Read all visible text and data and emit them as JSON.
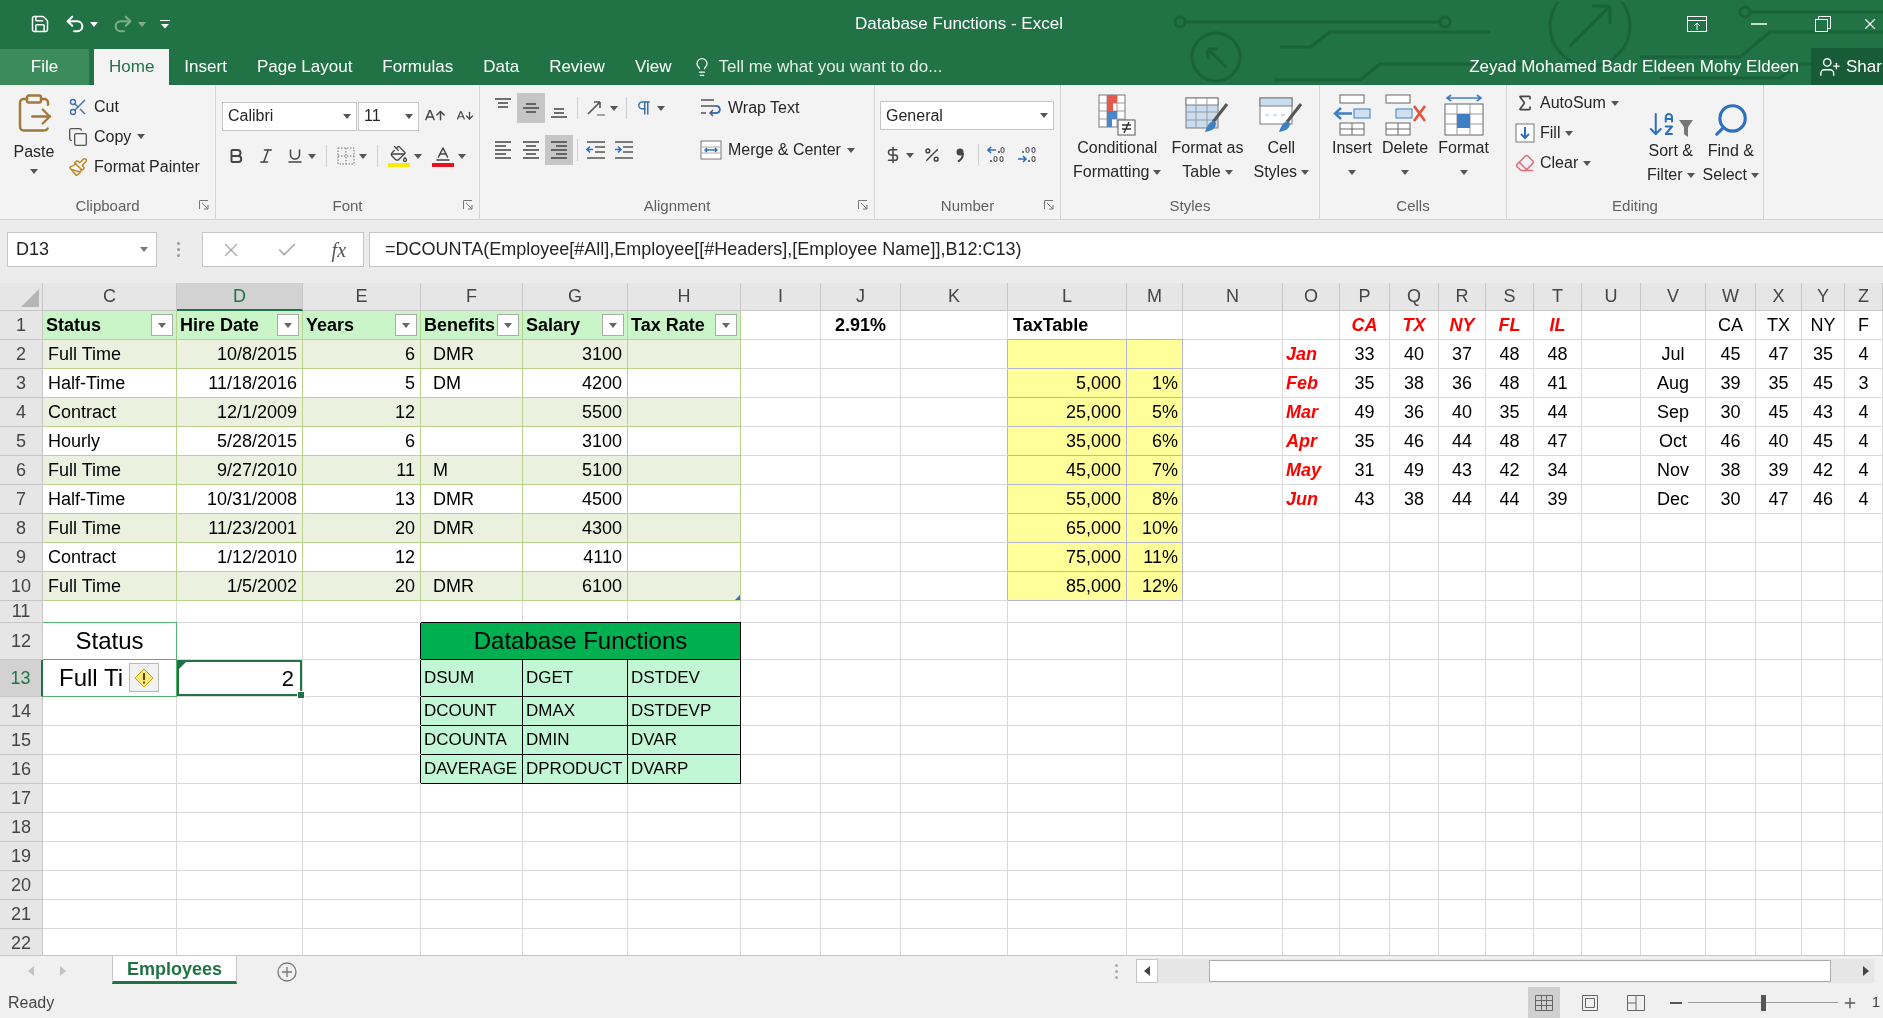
{
  "window": {
    "title": "Database Functions - Excel"
  },
  "quick_access": [
    {
      "kind": "save",
      "disabled": false
    },
    {
      "kind": "undo",
      "disabled": false
    },
    {
      "kind": "redo",
      "disabled": true
    },
    {
      "kind": "customize",
      "disabled": false
    }
  ],
  "tabs": [
    {
      "label": "File",
      "kind": "file",
      "selected": false
    },
    {
      "label": "Home",
      "kind": "tab",
      "selected": true
    },
    {
      "label": "Insert",
      "kind": "tab",
      "selected": false
    },
    {
      "label": "Page Layout",
      "kind": "tab",
      "selected": false
    },
    {
      "label": "Formulas",
      "kind": "tab",
      "selected": false
    },
    {
      "label": "Data",
      "kind": "tab",
      "selected": false
    },
    {
      "label": "Review",
      "kind": "tab",
      "selected": false
    },
    {
      "label": "View",
      "kind": "tab",
      "selected": false
    }
  ],
  "tell_me": {
    "placeholder": "Tell me what you want to do..."
  },
  "account": {
    "user_name": "Zeyad Mohamed Badr Eldeen Mohy Eldeen",
    "share_label": "Shar"
  },
  "ribbon": {
    "clipboard": {
      "label": "Clipboard",
      "paste": "Paste",
      "cut": "Cut",
      "copy": "Copy",
      "format_painter": "Format Painter"
    },
    "font": {
      "label": "Font",
      "font_name": "Calibri",
      "font_size": "11"
    },
    "alignment": {
      "label": "Alignment",
      "vertical": [
        {
          "kind": "top",
          "selected": false
        },
        {
          "kind": "middle",
          "selected": true
        },
        {
          "kind": "bottom",
          "selected": false
        }
      ],
      "horizontal": [
        {
          "kind": "left",
          "selected": false
        },
        {
          "kind": "center",
          "selected": false
        },
        {
          "kind": "right",
          "selected": true
        }
      ],
      "wrap_text": "Wrap Text",
      "merge_center": "Merge & Center"
    },
    "number": {
      "label": "Number",
      "format": "General"
    },
    "styles": {
      "label": "Styles",
      "buttons": [
        {
          "kind": "conditional",
          "label_lines": [
            "Conditional",
            "Formatting"
          ]
        },
        {
          "kind": "table",
          "label_lines": [
            "Format as",
            "Table"
          ]
        },
        {
          "kind": "cell_styles",
          "label_lines": [
            "Cell",
            "Styles"
          ]
        }
      ]
    },
    "cells": {
      "label": "Cells",
      "buttons": [
        {
          "kind": "insert",
          "label": "Insert"
        },
        {
          "kind": "delete",
          "label": "Delete"
        },
        {
          "kind": "format",
          "label": "Format"
        }
      ]
    },
    "editing": {
      "label": "Editing",
      "autosum": "AutoSum",
      "fill": "Fill",
      "clear": "Clear",
      "sort_filter": [
        "Sort &",
        "Filter"
      ],
      "find_select": [
        "Find &",
        "Select"
      ]
    }
  },
  "formula_bar": {
    "name_box": "D13",
    "function_label": "fx",
    "formula": "=DCOUNTA(Employee[#All],Employee[[#Headers],[Employee Name]],B12:C13)"
  },
  "sheet": {
    "columns": [
      {
        "label": "C",
        "selected": false
      },
      {
        "label": "D",
        "selected": true
      },
      {
        "label": "E",
        "selected": false
      },
      {
        "label": "F",
        "selected": false
      },
      {
        "label": "G",
        "selected": false
      },
      {
        "label": "H",
        "selected": false
      },
      {
        "label": "I",
        "selected": false
      },
      {
        "label": "J",
        "selected": false
      },
      {
        "label": "K",
        "selected": false
      },
      {
        "label": "L",
        "selected": false
      },
      {
        "label": "M",
        "selected": false
      },
      {
        "label": "N",
        "selected": false
      },
      {
        "label": "O",
        "selected": false
      },
      {
        "label": "P",
        "selected": false
      },
      {
        "label": "Q",
        "selected": false
      },
      {
        "label": "R",
        "selected": false
      },
      {
        "label": "S",
        "selected": false
      },
      {
        "label": "T",
        "selected": false
      },
      {
        "label": "U",
        "selected": false
      },
      {
        "label": "V",
        "selected": false
      },
      {
        "label": "W",
        "selected": false
      },
      {
        "label": "X",
        "selected": false
      },
      {
        "label": "Y",
        "selected": false
      },
      {
        "label": "Z",
        "selected": false
      }
    ],
    "rows": [
      {
        "label": "1",
        "selected": false
      },
      {
        "label": "2",
        "selected": false
      },
      {
        "label": "3",
        "selected": false
      },
      {
        "label": "4",
        "selected": false
      },
      {
        "label": "5",
        "selected": false
      },
      {
        "label": "6",
        "selected": false
      },
      {
        "label": "7",
        "selected": false
      },
      {
        "label": "8",
        "selected": false
      },
      {
        "label": "9",
        "selected": false
      },
      {
        "label": "10",
        "selected": false
      },
      {
        "label": "11",
        "selected": false
      },
      {
        "label": "12",
        "selected": false
      },
      {
        "label": "13",
        "selected": true
      },
      {
        "label": "14",
        "selected": false
      },
      {
        "label": "15",
        "selected": false
      },
      {
        "label": "16",
        "selected": false
      },
      {
        "label": "17",
        "selected": false
      },
      {
        "label": "18",
        "selected": false
      },
      {
        "label": "19",
        "selected": false
      },
      {
        "label": "20",
        "selected": false
      },
      {
        "label": "21",
        "selected": false
      },
      {
        "label": "22",
        "selected": false
      }
    ],
    "employee_table": {
      "headers": [
        "Status",
        "Hire Date",
        "Years",
        "Benefits",
        "Salary",
        "Tax Rate"
      ],
      "rows": [
        {
          "status": "Full Time",
          "hire_date": "10/8/2015",
          "years": "6",
          "benefits": "DMR",
          "salary": "3100"
        },
        {
          "status": "Half-Time",
          "hire_date": "11/18/2016",
          "years": "5",
          "benefits": "DM",
          "salary": "4200"
        },
        {
          "status": "Contract",
          "hire_date": "12/1/2009",
          "years": "12",
          "salary": "5500"
        },
        {
          "status": "Hourly",
          "hire_date": "5/28/2015",
          "years": "6",
          "salary": "3100"
        },
        {
          "status": "Full Time",
          "hire_date": "9/27/2010",
          "years": "11",
          "benefits": "M",
          "salary": "5100"
        },
        {
          "status": "Half-Time",
          "hire_date": "10/31/2008",
          "years": "13",
          "benefits": "DMR",
          "salary": "4500"
        },
        {
          "status": "Full Time",
          "hire_date": "11/23/2001",
          "years": "20",
          "benefits": "DMR",
          "salary": "4300"
        },
        {
          "status": "Contract",
          "hire_date": "1/12/2010",
          "years": "12",
          "salary": "4110"
        },
        {
          "status": "Full Time",
          "hire_date": "1/5/2002",
          "years": "20",
          "benefits": "DMR",
          "salary": "6100"
        }
      ]
    },
    "criteria": {
      "header": "Status",
      "value": "Full Ti"
    },
    "result": {
      "value": "2",
      "selected": true,
      "error_flag": true
    },
    "total_rate": "2.91%",
    "tax_table": {
      "title": "TaxTable",
      "rows": [
        {},
        {
          "threshold": "5,000",
          "rate": "1%"
        },
        {
          "threshold": "25,000",
          "rate": "5%"
        },
        {
          "threshold": "35,000",
          "rate": "6%"
        },
        {
          "threshold": "45,000",
          "rate": "7%"
        },
        {
          "threshold": "55,000",
          "rate": "8%"
        },
        {
          "threshold": "65,000",
          "rate": "10%"
        },
        {
          "threshold": "75,000",
          "rate": "11%"
        },
        {
          "threshold": "85,000",
          "rate": "12%"
        }
      ]
    },
    "database_functions": {
      "title": "Database Functions",
      "rows": [
        [
          "DSUM",
          "DGET",
          "DSTDEV"
        ],
        [
          "DCOUNT",
          "DMAX",
          "DSTDEVP"
        ],
        [
          "DCOUNTA",
          "DMIN",
          "DVAR"
        ],
        [
          "DAVERAGE",
          "DPRODUCT",
          "DVARP"
        ]
      ]
    },
    "first_half": {
      "states": [
        "CA",
        "TX",
        "NY",
        "FL",
        "IL"
      ],
      "rows": [
        {
          "month": "Jan",
          "values": [
            "33",
            "40",
            "37",
            "48",
            "48"
          ]
        },
        {
          "month": "Feb",
          "values": [
            "35",
            "38",
            "36",
            "48",
            "41"
          ]
        },
        {
          "month": "Mar",
          "values": [
            "49",
            "36",
            "40",
            "35",
            "44"
          ]
        },
        {
          "month": "Apr",
          "values": [
            "35",
            "46",
            "44",
            "48",
            "47"
          ]
        },
        {
          "month": "May",
          "values": [
            "31",
            "49",
            "43",
            "42",
            "34"
          ]
        },
        {
          "month": "Jun",
          "values": [
            "43",
            "38",
            "44",
            "44",
            "39"
          ]
        }
      ]
    },
    "second_half": {
      "states": [
        "CA",
        "TX",
        "NY",
        "F"
      ],
      "rows": [
        {
          "month": "Jul",
          "values": [
            "45",
            "47",
            "35",
            "4"
          ]
        },
        {
          "month": "Aug",
          "values": [
            "39",
            "35",
            "45",
            "3"
          ]
        },
        {
          "month": "Sep",
          "values": [
            "30",
            "45",
            "43",
            "4"
          ]
        },
        {
          "month": "Oct",
          "values": [
            "46",
            "40",
            "45",
            "4"
          ]
        },
        {
          "month": "Nov",
          "values": [
            "38",
            "39",
            "42",
            "4"
          ]
        },
        {
          "month": "Dec",
          "values": [
            "30",
            "47",
            "46",
            "4"
          ]
        }
      ]
    }
  },
  "sheet_tabs": [
    {
      "label": "Employees",
      "selected": true
    }
  ],
  "status_bar": {
    "status": "Ready",
    "views": [
      {
        "kind": "normal",
        "selected": true
      },
      {
        "kind": "page_layout",
        "selected": false
      },
      {
        "kind": "page_break",
        "selected": false
      }
    ],
    "zoom_slider": {
      "level": 0.5
    },
    "zoom_text": "1"
  }
}
